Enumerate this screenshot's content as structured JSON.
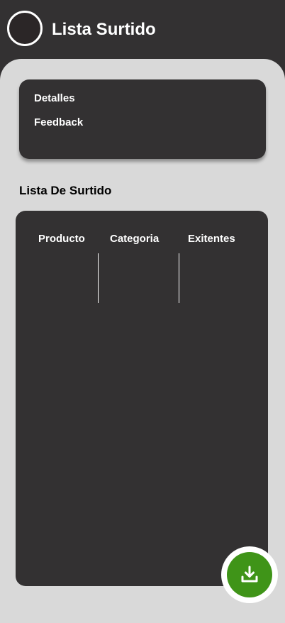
{
  "header": {
    "title": "Lista Surtido",
    "avatar_icon": "user-avatar"
  },
  "menu": {
    "items": [
      {
        "label": "Detalles"
      },
      {
        "label": "Feedback"
      }
    ]
  },
  "section": {
    "title": "Lista De Surtido"
  },
  "table": {
    "columns": [
      "Producto",
      "Categoria",
      "Exitentes"
    ],
    "rows": []
  },
  "fab": {
    "icon": "download-icon",
    "color": "#3f9418"
  },
  "colors": {
    "dark": "#333132",
    "background": "#d9d9d9",
    "accent": "#3f9418"
  }
}
